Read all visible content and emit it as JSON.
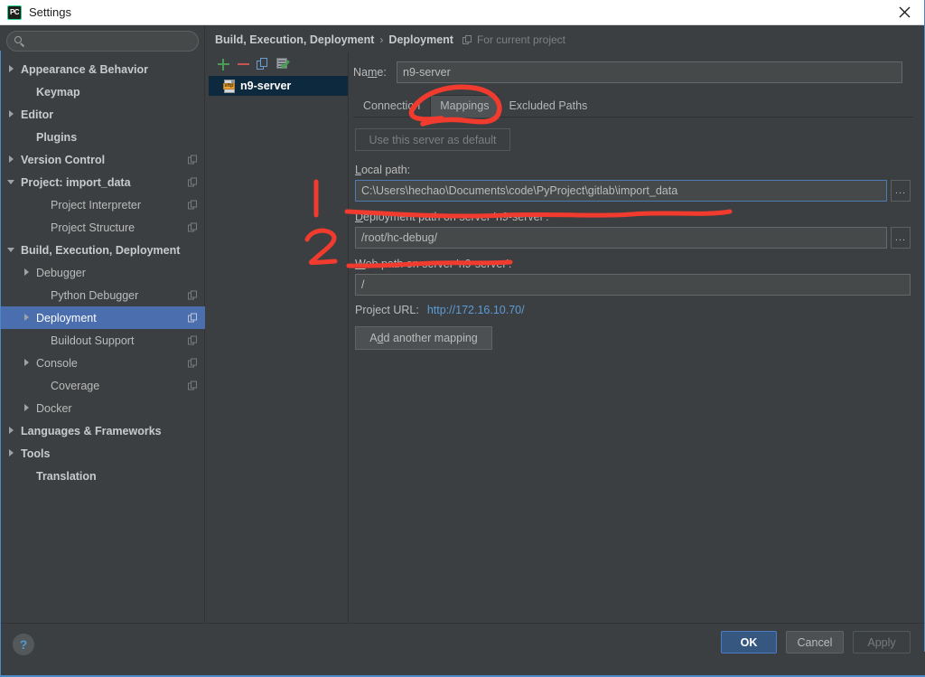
{
  "window": {
    "title": "Settings",
    "logo_text": "PC",
    "close_label": "✕"
  },
  "sidebar": {
    "search": {
      "value": "",
      "placeholder": ""
    },
    "items": [
      {
        "label": "Appearance & Behavior",
        "arrow": "right",
        "bold": true,
        "indent": 8,
        "badge": false,
        "selected": false
      },
      {
        "label": "Keymap",
        "arrow": "none",
        "bold": true,
        "indent": 25,
        "badge": false,
        "selected": false
      },
      {
        "label": "Editor",
        "arrow": "right",
        "bold": true,
        "indent": 8,
        "badge": false,
        "selected": false
      },
      {
        "label": "Plugins",
        "arrow": "none",
        "bold": true,
        "indent": 25,
        "badge": false,
        "selected": false
      },
      {
        "label": "Version Control",
        "arrow": "right",
        "bold": true,
        "indent": 8,
        "badge": true,
        "selected": false
      },
      {
        "label": "Project: import_data",
        "arrow": "down",
        "bold": true,
        "indent": 8,
        "badge": true,
        "selected": false
      },
      {
        "label": "Project Interpreter",
        "arrow": "none",
        "bold": false,
        "indent": 41,
        "badge": true,
        "selected": false
      },
      {
        "label": "Project Structure",
        "arrow": "none",
        "bold": false,
        "indent": 41,
        "badge": true,
        "selected": false
      },
      {
        "label": "Build, Execution, Deployment",
        "arrow": "down",
        "bold": true,
        "indent": 8,
        "badge": false,
        "selected": false
      },
      {
        "label": "Debugger",
        "arrow": "right",
        "bold": false,
        "indent": 25,
        "badge": false,
        "selected": false
      },
      {
        "label": "Python Debugger",
        "arrow": "none",
        "bold": false,
        "indent": 41,
        "badge": true,
        "selected": false
      },
      {
        "label": "Deployment",
        "arrow": "right",
        "bold": false,
        "indent": 25,
        "badge": true,
        "selected": true
      },
      {
        "label": "Buildout Support",
        "arrow": "none",
        "bold": false,
        "indent": 41,
        "badge": true,
        "selected": false
      },
      {
        "label": "Console",
        "arrow": "right",
        "bold": false,
        "indent": 25,
        "badge": true,
        "selected": false
      },
      {
        "label": "Coverage",
        "arrow": "none",
        "bold": false,
        "indent": 41,
        "badge": true,
        "selected": false
      },
      {
        "label": "Docker",
        "arrow": "right",
        "bold": false,
        "indent": 25,
        "badge": false,
        "selected": false
      },
      {
        "label": "Languages & Frameworks",
        "arrow": "right",
        "bold": true,
        "indent": 8,
        "badge": false,
        "selected": false
      },
      {
        "label": "Tools",
        "arrow": "right",
        "bold": true,
        "indent": 8,
        "badge": false,
        "selected": false
      },
      {
        "label": "Translation",
        "arrow": "none",
        "bold": true,
        "indent": 25,
        "badge": false,
        "selected": false
      }
    ]
  },
  "breadcrumb": {
    "main": "Build, Execution, Deployment",
    "separator": "›",
    "sub": "Deployment",
    "scope": "For current project"
  },
  "server_panel": {
    "toolbar": {
      "add": "+",
      "remove": "−",
      "copy": "copy-server",
      "default": "set-default-server"
    },
    "items": [
      {
        "name": "n9-server",
        "icon_text": "sftp",
        "selected": true
      }
    ]
  },
  "detail": {
    "name_label": "Name:",
    "name_value": "n9-server",
    "tabs": [
      {
        "label": "Connection",
        "active": false
      },
      {
        "label": "Mappings",
        "active": true
      },
      {
        "label": "Excluded Paths",
        "active": false
      }
    ],
    "use_default_button": "Use this server as default",
    "local_path": {
      "label": "Local path:",
      "value": "C:\\Users\\hechao\\Documents\\code\\PyProject\\gitlab\\import_data",
      "browse": "..."
    },
    "deployment_path": {
      "label": "Deployment path on server 'n9-server':",
      "value": "/root/hc-debug/",
      "browse": "..."
    },
    "web_path": {
      "label": "Web path on server 'n9-server':",
      "value": "/"
    },
    "project_url": {
      "label": "Project URL:",
      "value": "http://172.16.10.70/"
    },
    "add_mapping_button": "Add another mapping"
  },
  "footer": {
    "help": "?",
    "ok": "OK",
    "cancel": "Cancel",
    "apply": "Apply"
  },
  "annotations": {
    "marker_one": "1",
    "marker_two": "2",
    "circle_target": "Mappings",
    "color": "#f03b2e"
  }
}
